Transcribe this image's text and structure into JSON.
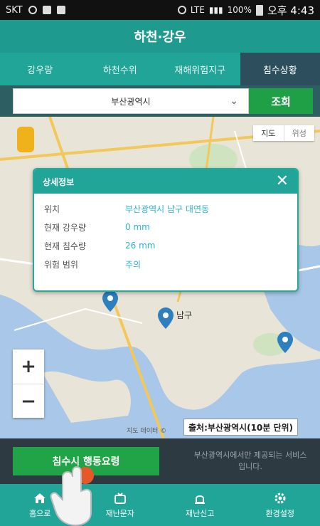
{
  "status_bar": {
    "carrier": "SKT",
    "network": "LTE",
    "battery": "100%",
    "time": "오후 4:43"
  },
  "app": {
    "title": "하천·강우"
  },
  "tabs": [
    {
      "label": "강우량",
      "active": false
    },
    {
      "label": "하천수위",
      "active": false
    },
    {
      "label": "재해위험지구",
      "active": false
    },
    {
      "label": "침수상황",
      "active": true
    }
  ],
  "region": {
    "selected": "부산광역시",
    "query_label": "조회"
  },
  "map": {
    "map_type": [
      "지도",
      "위성"
    ],
    "zoom_in": "+",
    "zoom_out": "−",
    "source_label": "출처:부산광역시(10분 단위)",
    "attribution": "지도 데이터 ©",
    "place_labels": [
      "남구"
    ]
  },
  "popup": {
    "title": "상세정보",
    "close": "✕",
    "rows": [
      {
        "key": "위치",
        "value": "부산광역시 남구 대연동"
      },
      {
        "key": "현재 강우량",
        "value": "0 mm"
      },
      {
        "key": "현재 침수량",
        "value": "26 mm"
      },
      {
        "key": "위험 범위",
        "value": "주의"
      }
    ]
  },
  "action": {
    "button_label": "침수시 행동요령",
    "note": "부산광역시에서만 제공되는 서비스입니다."
  },
  "nav": [
    {
      "label": "홈으로",
      "icon": "home-icon"
    },
    {
      "label": "재난문자",
      "icon": "message-icon"
    },
    {
      "label": "재난신고",
      "icon": "siren-icon"
    },
    {
      "label": "환경설정",
      "icon": "gear-icon"
    }
  ],
  "colors": {
    "teal": "#20a598",
    "header_teal": "#1f9a8e",
    "green": "#21a448",
    "tab_active": "#2d4f5d",
    "link_blue": "#2bb3d1"
  }
}
